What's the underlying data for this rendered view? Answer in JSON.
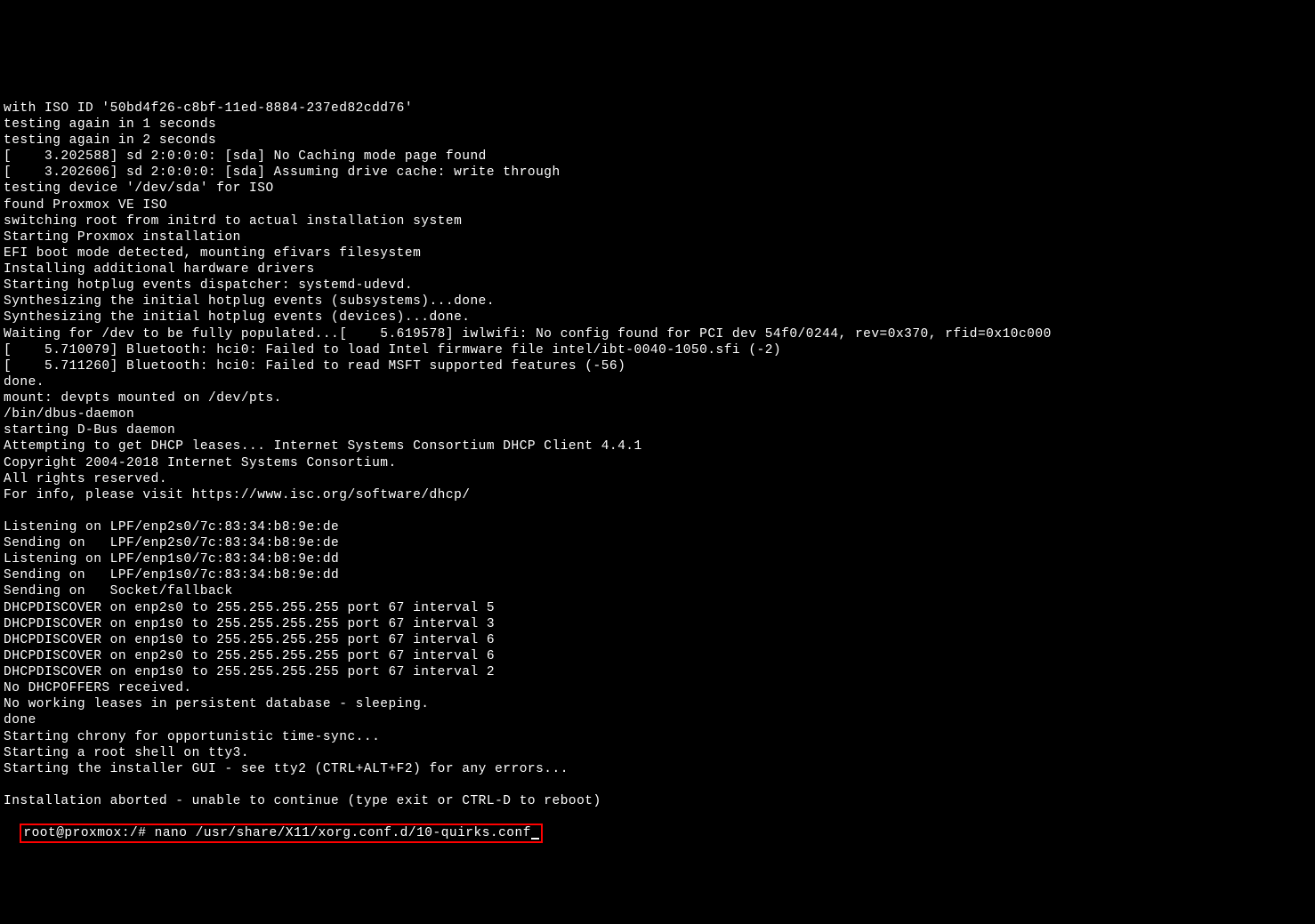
{
  "terminal": {
    "lines": [
      "with ISO ID '50bd4f26-c8bf-11ed-8884-237ed82cdd76'",
      "testing again in 1 seconds",
      "testing again in 2 seconds",
      "[    3.202588] sd 2:0:0:0: [sda] No Caching mode page found",
      "[    3.202606] sd 2:0:0:0: [sda] Assuming drive cache: write through",
      "testing device '/dev/sda' for ISO",
      "found Proxmox VE ISO",
      "switching root from initrd to actual installation system",
      "Starting Proxmox installation",
      "EFI boot mode detected, mounting efivars filesystem",
      "Installing additional hardware drivers",
      "Starting hotplug events dispatcher: systemd-udevd.",
      "Synthesizing the initial hotplug events (subsystems)...done.",
      "Synthesizing the initial hotplug events (devices)...done.",
      "Waiting for /dev to be fully populated...[    5.619578] iwlwifi: No config found for PCI dev 54f0/0244, rev=0x370, rfid=0x10c000",
      "[    5.710079] Bluetooth: hci0: Failed to load Intel firmware file intel/ibt-0040-1050.sfi (-2)",
      "[    5.711260] Bluetooth: hci0: Failed to read MSFT supported features (-56)",
      "done.",
      "mount: devpts mounted on /dev/pts.",
      "/bin/dbus-daemon",
      "starting D-Bus daemon",
      "Attempting to get DHCP leases... Internet Systems Consortium DHCP Client 4.4.1",
      "Copyright 2004-2018 Internet Systems Consortium.",
      "All rights reserved.",
      "For info, please visit https://www.isc.org/software/dhcp/",
      "",
      "Listening on LPF/enp2s0/7c:83:34:b8:9e:de",
      "Sending on   LPF/enp2s0/7c:83:34:b8:9e:de",
      "Listening on LPF/enp1s0/7c:83:34:b8:9e:dd",
      "Sending on   LPF/enp1s0/7c:83:34:b8:9e:dd",
      "Sending on   Socket/fallback",
      "DHCPDISCOVER on enp2s0 to 255.255.255.255 port 67 interval 5",
      "DHCPDISCOVER on enp1s0 to 255.255.255.255 port 67 interval 3",
      "DHCPDISCOVER on enp1s0 to 255.255.255.255 port 67 interval 6",
      "DHCPDISCOVER on enp2s0 to 255.255.255.255 port 67 interval 6",
      "DHCPDISCOVER on enp1s0 to 255.255.255.255 port 67 interval 2",
      "No DHCPOFFERS received.",
      "No working leases in persistent database - sleeping.",
      "done",
      "Starting chrony for opportunistic time-sync...",
      "Starting a root shell on tty3.",
      "Starting the installer GUI - see tty2 (CTRL+ALT+F2) for any errors...",
      "",
      "Installation aborted - unable to continue (type exit or CTRL-D to reboot)"
    ],
    "prompt": "root@proxmox:/# ",
    "command": "nano /usr/share/X11/xorg.conf.d/10-quirks.conf"
  }
}
